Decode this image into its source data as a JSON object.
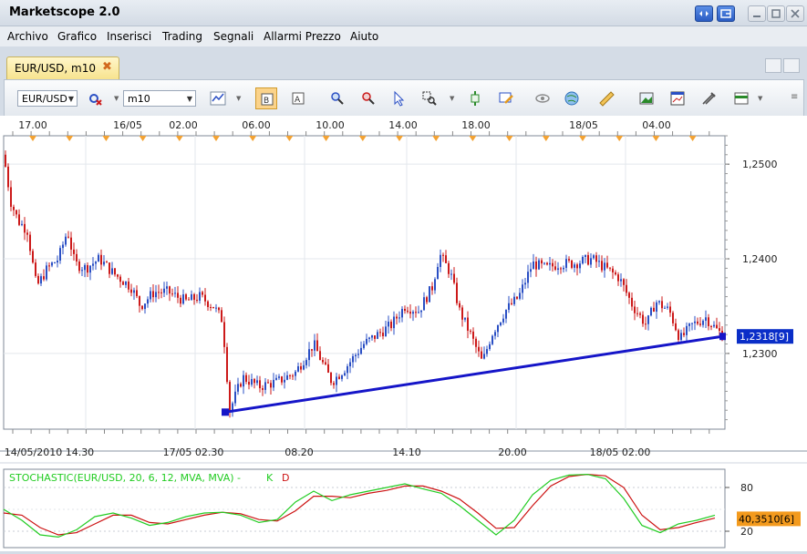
{
  "window": {
    "title": "Marketscope 2.0"
  },
  "menu": [
    "Archivo",
    "Grafico",
    "Inserisci",
    "Trading",
    "Segnali",
    "Allarmi Prezzo",
    "Aiuto"
  ],
  "tab": {
    "label": "EUR/USD, m10",
    "close": "✖"
  },
  "toolbar": {
    "instrument": "EUR/USD",
    "timeframe": "m10",
    "icons": [
      "bar-chart-icon",
      "candle-mode-icon",
      "bid-ask-icon",
      "zoom-in-icon",
      "zoom-out-icon",
      "cursor-icon",
      "zoom-rect-icon",
      "indicator-icon",
      "draw-icon",
      "eye-icon",
      "globe-icon",
      "ruler-icon",
      "image-icon",
      "chart-window-icon",
      "tools-icon",
      "export-icon"
    ]
  },
  "colors": {
    "candle_up": "#2a4fc4",
    "candle_down": "#cc1a1a",
    "trendline": "#1515c8",
    "stoch_k": "#22cc22",
    "stoch_d": "#cc1111",
    "price_badge": "#0a2ec8",
    "stoch_badge": "#f39a1d"
  },
  "chart_data": {
    "type": "candlestick",
    "instrument": "EUR/USD",
    "timeframe": "m10",
    "top_axis_labels": [
      "17.00",
      "16/05",
      "02.00",
      "06.00",
      "10.00",
      "14.00",
      "18.00",
      "18/05",
      "04.00"
    ],
    "bottom_axis_labels": [
      "14/05/2010 14.30",
      "17/05 02.30",
      "08.20",
      "14.10",
      "20.00",
      "18/05 02.00"
    ],
    "price_ticks": [
      "1,2500",
      "1,2400",
      "1,2300"
    ],
    "ylim": [
      1.222,
      1.253
    ],
    "current_price_label": "1,2318[9]",
    "close_path": [
      [
        0,
        1.251
      ],
      [
        8,
        1.246
      ],
      [
        16,
        1.244
      ],
      [
        26,
        1.243
      ],
      [
        36,
        1.237
      ],
      [
        48,
        1.239
      ],
      [
        60,
        1.24
      ],
      [
        70,
        1.243
      ],
      [
        78,
        1.2395
      ],
      [
        90,
        1.239
      ],
      [
        105,
        1.24
      ],
      [
        120,
        1.2385
      ],
      [
        140,
        1.237
      ],
      [
        150,
        1.235
      ],
      [
        165,
        1.2365
      ],
      [
        180,
        1.2365
      ],
      [
        200,
        1.2355
      ],
      [
        215,
        1.236
      ],
      [
        230,
        1.235
      ],
      [
        240,
        1.2335
      ],
      [
        248,
        1.224
      ],
      [
        262,
        1.2275
      ],
      [
        280,
        1.2265
      ],
      [
        300,
        1.227
      ],
      [
        320,
        1.228
      ],
      [
        340,
        1.231
      ],
      [
        352,
        1.2285
      ],
      [
        360,
        1.227
      ],
      [
        375,
        1.2285
      ],
      [
        395,
        1.231
      ],
      [
        410,
        1.232
      ],
      [
        425,
        1.233
      ],
      [
        440,
        1.235
      ],
      [
        455,
        1.2345
      ],
      [
        470,
        1.237
      ],
      [
        478,
        1.2405
      ],
      [
        490,
        1.2385
      ],
      [
        500,
        1.2345
      ],
      [
        512,
        1.232
      ],
      [
        525,
        1.229
      ],
      [
        535,
        1.232
      ],
      [
        550,
        1.2345
      ],
      [
        565,
        1.236
      ],
      [
        580,
        1.2395
      ],
      [
        595,
        1.239
      ],
      [
        610,
        1.2395
      ],
      [
        625,
        1.2395
      ],
      [
        645,
        1.24
      ],
      [
        660,
        1.239
      ],
      [
        675,
        1.238
      ],
      [
        690,
        1.235
      ],
      [
        705,
        1.233
      ],
      [
        715,
        1.2355
      ],
      [
        730,
        1.2345
      ],
      [
        742,
        1.2315
      ],
      [
        755,
        1.233
      ],
      [
        770,
        1.2338
      ],
      [
        782,
        1.2325
      ],
      [
        790,
        1.2318
      ]
    ],
    "trendline": {
      "from": [
        247,
        1.2238
      ],
      "to": [
        792,
        1.2318
      ]
    },
    "stochastic": {
      "title": "STOCHASTIC(EUR/USD, 20, 6, 12, MVA, MVA) -",
      "k_label": "K",
      "d_label": "D",
      "levels": [
        "80",
        "20"
      ],
      "current_label": "40,3510[6]",
      "ylim": [
        0,
        100
      ],
      "k": [
        [
          0,
          50
        ],
        [
          20,
          35
        ],
        [
          40,
          15
        ],
        [
          60,
          12
        ],
        [
          80,
          22
        ],
        [
          100,
          40
        ],
        [
          120,
          45
        ],
        [
          140,
          38
        ],
        [
          160,
          28
        ],
        [
          180,
          32
        ],
        [
          200,
          40
        ],
        [
          220,
          45
        ],
        [
          240,
          46
        ],
        [
          260,
          42
        ],
        [
          280,
          32
        ],
        [
          300,
          36
        ],
        [
          320,
          60
        ],
        [
          340,
          75
        ],
        [
          360,
          62
        ],
        [
          380,
          70
        ],
        [
          400,
          75
        ],
        [
          420,
          80
        ],
        [
          440,
          85
        ],
        [
          460,
          78
        ],
        [
          480,
          72
        ],
        [
          500,
          55
        ],
        [
          520,
          35
        ],
        [
          540,
          15
        ],
        [
          560,
          35
        ],
        [
          580,
          70
        ],
        [
          600,
          90
        ],
        [
          620,
          97
        ],
        [
          640,
          98
        ],
        [
          660,
          92
        ],
        [
          680,
          65
        ],
        [
          700,
          28
        ],
        [
          720,
          18
        ],
        [
          740,
          30
        ],
        [
          760,
          35
        ],
        [
          780,
          42
        ]
      ],
      "d": [
        [
          0,
          45
        ],
        [
          20,
          42
        ],
        [
          40,
          25
        ],
        [
          60,
          15
        ],
        [
          80,
          18
        ],
        [
          100,
          30
        ],
        [
          120,
          42
        ],
        [
          140,
          42
        ],
        [
          160,
          32
        ],
        [
          180,
          30
        ],
        [
          200,
          36
        ],
        [
          220,
          42
        ],
        [
          240,
          46
        ],
        [
          260,
          44
        ],
        [
          280,
          36
        ],
        [
          300,
          34
        ],
        [
          320,
          48
        ],
        [
          340,
          68
        ],
        [
          360,
          68
        ],
        [
          380,
          66
        ],
        [
          400,
          72
        ],
        [
          420,
          76
        ],
        [
          440,
          82
        ],
        [
          460,
          82
        ],
        [
          480,
          75
        ],
        [
          500,
          64
        ],
        [
          520,
          45
        ],
        [
          540,
          24
        ],
        [
          560,
          25
        ],
        [
          580,
          55
        ],
        [
          600,
          82
        ],
        [
          620,
          95
        ],
        [
          640,
          98
        ],
        [
          660,
          96
        ],
        [
          680,
          80
        ],
        [
          700,
          42
        ],
        [
          720,
          22
        ],
        [
          740,
          25
        ],
        [
          760,
          32
        ],
        [
          780,
          38
        ]
      ]
    }
  }
}
